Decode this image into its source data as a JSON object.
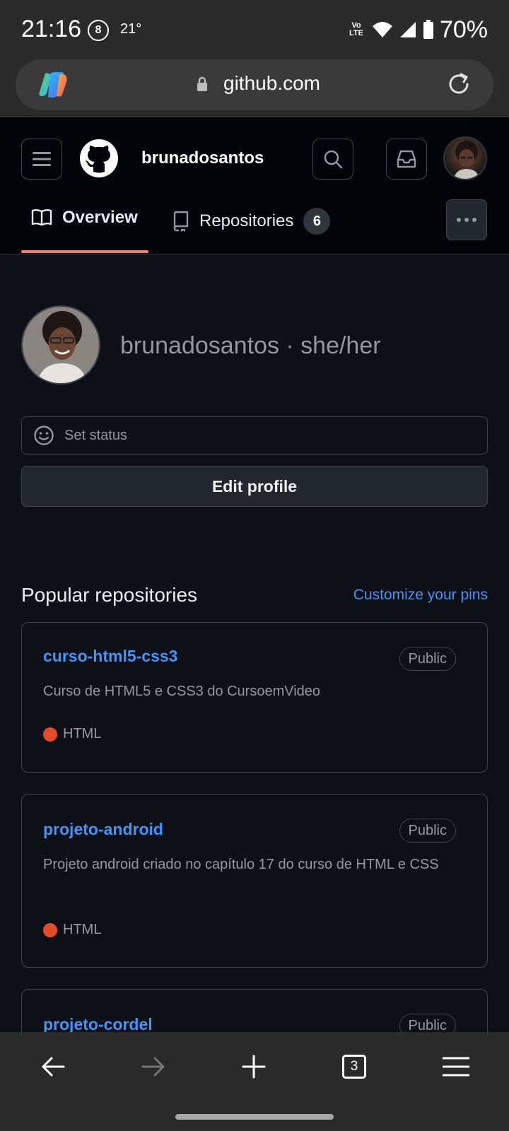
{
  "status_bar": {
    "time": "21:16",
    "notification_badge": "8",
    "temperature": "21°",
    "network_label": "Vo LTE",
    "battery": "70%"
  },
  "browser": {
    "url": "github.com"
  },
  "header": {
    "username": "brunadosantos"
  },
  "tabs": {
    "overview": "Overview",
    "repositories": "Repositories",
    "repositories_count": "6"
  },
  "profile": {
    "display": "brunadosantos · she/her",
    "set_status": "Set status",
    "edit_profile": "Edit profile"
  },
  "popular": {
    "title": "Popular repositories",
    "customize": "Customize your pins",
    "repos": [
      {
        "name": "curso-html5-css3",
        "visibility": "Public",
        "description": "Curso de HTML5 e CSS3 do CursoemVideo",
        "language": "HTML",
        "language_color": "#e34c26"
      },
      {
        "name": "projeto-android",
        "visibility": "Public",
        "description": "Projeto android criado no capítulo 17 do curso de HTML e CSS",
        "language": "HTML",
        "language_color": "#e34c26"
      },
      {
        "name": "projeto-cordel",
        "visibility": "Public"
      }
    ]
  },
  "bottom_nav": {
    "tab_count": "3"
  },
  "colors": {
    "accent_link": "#4493f8",
    "tab_underline": "#f78166",
    "background": "#0d1117"
  }
}
